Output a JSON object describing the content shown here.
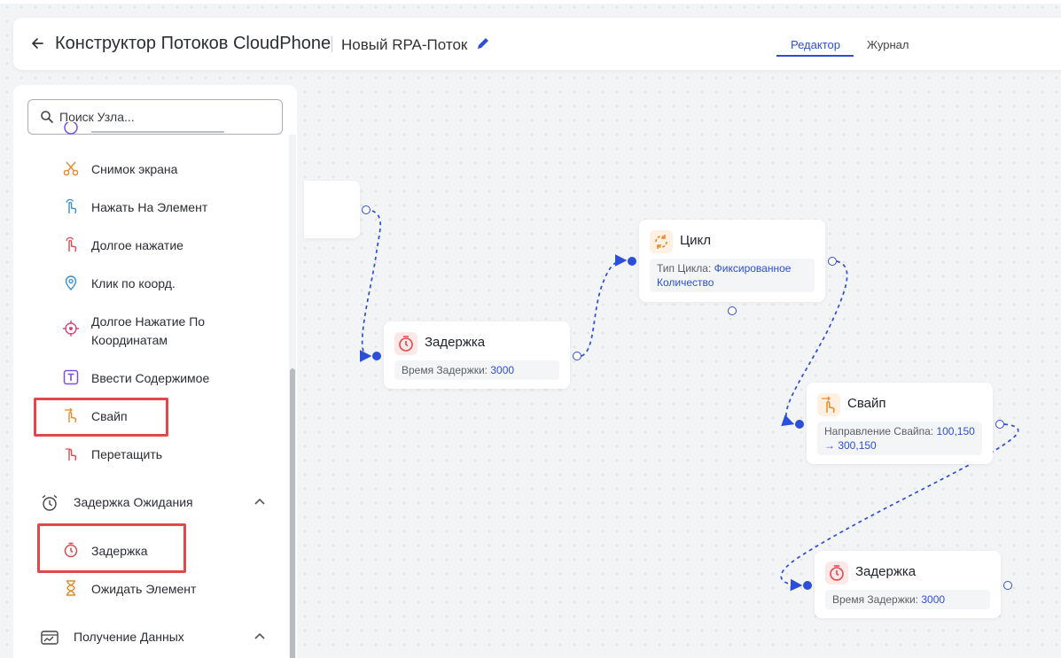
{
  "header": {
    "title": "Конструктор Потоков CloudPhone",
    "flow_name": "Новый RPA-Поток",
    "tabs": [
      {
        "label": "Редактор",
        "active": true
      },
      {
        "label": "Журнал",
        "active": false
      }
    ]
  },
  "sidebar": {
    "search_placeholder": "Поиск Узла...",
    "items": [
      {
        "label": "Снимок экрана",
        "icon": "scissors-icon"
      },
      {
        "label": "Нажать На Элемент",
        "icon": "tap-hand-icon"
      },
      {
        "label": "Долгое нажатие",
        "icon": "long-press-hand-icon"
      },
      {
        "label": "Клик по коорд.",
        "icon": "location-pin-icon"
      },
      {
        "label": "Долгое Нажатие По Координатам",
        "icon": "crosshair-icon"
      },
      {
        "label": "Ввести Содержимое",
        "icon": "text-input-icon"
      },
      {
        "label": "Свайп",
        "icon": "swipe-hand-icon"
      },
      {
        "label": "Перетащить",
        "icon": "drag-hand-icon"
      }
    ],
    "categories": [
      {
        "label": "Задержка Ожидания",
        "icon": "alarm-clock-icon",
        "items": [
          {
            "label": "Задержка",
            "icon": "stopwatch-icon"
          },
          {
            "label": "Ожидать Элемент",
            "icon": "hourglass-icon"
          }
        ]
      },
      {
        "label": "Получение Данных",
        "icon": "data-chart-icon"
      }
    ]
  },
  "canvas": {
    "nodes": [
      {
        "title": "Задержка",
        "param_label": "Время Задержки:",
        "param_value": "3000",
        "icon": "stopwatch-icon"
      },
      {
        "title": "Цикл",
        "param_label": "Тип Цикла:",
        "param_value": "Фиксированное Количество",
        "icon": "loop-icon"
      },
      {
        "title": "Свайп",
        "param_label": "Направление Свайпа:",
        "param_value": "100,150 → 300,150",
        "icon": "swipe-hand-icon"
      },
      {
        "title": "Задержка",
        "param_label": "Время Задержки:",
        "param_value": "3000",
        "icon": "stopwatch-icon"
      }
    ]
  },
  "colors": {
    "accent": "#2b4fd8",
    "highlight": "#e0484d",
    "icon_orange": "#e8892a",
    "icon_red": "#e0484d",
    "icon_purple": "#7b4fe0"
  }
}
